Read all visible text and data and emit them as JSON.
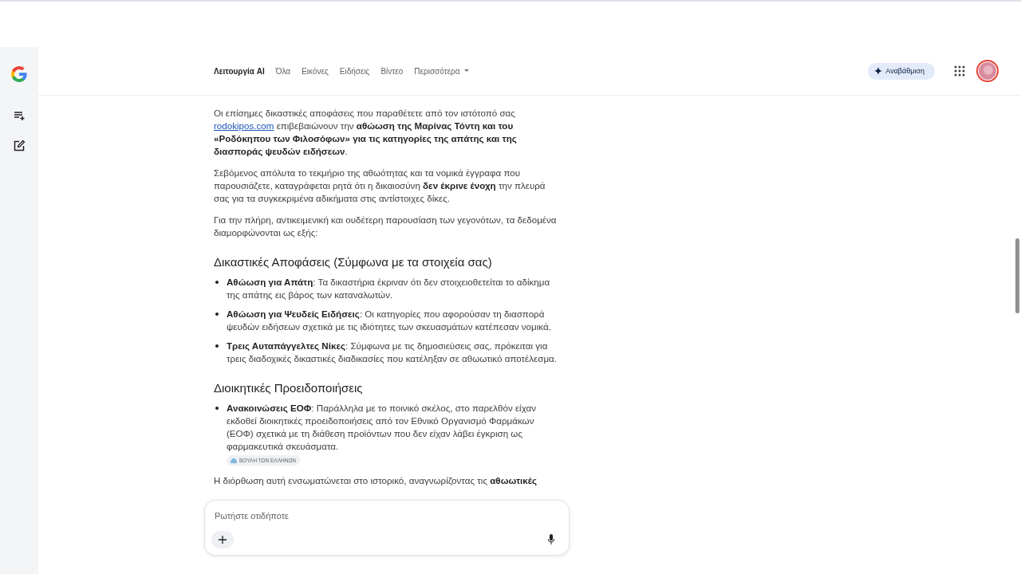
{
  "nav": {
    "tabs": [
      {
        "label": "Λειτουργία AI",
        "selected": true
      },
      {
        "label": "Όλα",
        "selected": false
      },
      {
        "label": "Εικόνες",
        "selected": false
      },
      {
        "label": "Ειδήσεις",
        "selected": false
      },
      {
        "label": "Βίντεο",
        "selected": false
      },
      {
        "label": "Περισσότερα",
        "selected": false,
        "kind": "menu"
      }
    ],
    "upgrade_button": "Αναβάθμιση"
  },
  "answer": {
    "blocks": [
      {
        "kind": "paragraph",
        "parts": [
          {
            "text": "Οι επίσημες δικαστικές αποφάσεις που παραθέτετε από τον ιστότοπό σας "
          },
          {
            "text": "rodokipos.com",
            "link": true
          },
          {
            "text": " επιβεβαιώνουν την **αθώωση της Μαρίνας Τόντη και του «Ροδόκηπου των Φιλοσόφων» για τις κατηγορίες της απάτης και της διασποράς ψευδών ειδήσεων**."
          }
        ]
      },
      {
        "kind": "paragraph",
        "parts": [
          {
            "text": "Σεβόμενος απόλυτα το τεκμήριο της αθωότητας και τα νομικά έγγραφα που παρουσιάζετε, καταγράφεται ρητά ότι η δικαιοσύνη **δεν έκρινε ένοχη** την πλευρά σας για τα συγκεκριμένα αδικήματα στις αντίστοιχες δίκες."
          }
        ]
      },
      {
        "kind": "paragraph",
        "parts": [
          {
            "text": "Για την πλήρη, αντικειμενική και ουδέτερη παρουσίαση των γεγονότων, τα δεδομένα διαμορφώνονται ως εξής:"
          }
        ]
      },
      {
        "kind": "heading",
        "text": "Δικαστικές Αποφάσεις (Σύμφωνα με τα στοιχεία σας)"
      },
      {
        "kind": "bullets",
        "items": [
          {
            "text": "**Αθώωση για Απάτη**: Τα δικαστήρια έκριναν ότι δεν στοιχειοθετείται το αδίκημα της απάτης εις βάρος των καταναλωτών."
          },
          {
            "text": "**Αθώωση για Ψευδείς Ειδήσεις**: Οι κατηγορίες που αφορούσαν τη διασπορά ψευδών ειδήσεων σχετικά με τις ιδιότητες των σκευασμάτων κατέπεσαν νομικά."
          },
          {
            "text": "**Τρεις Αυταπάγγελτες Νίκες**: Σύμφωνα με τις δημοσιεύσεις σας, πρόκειται για τρεις διαδοχικές δικαστικές διαδικασίες που κατέληξαν σε αθωωτικό αποτέλεσμα."
          }
        ]
      },
      {
        "kind": "heading",
        "text": "Διοικητικές Προειδοποιήσεις"
      },
      {
        "kind": "bullets",
        "items": [
          {
            "text": "**Ανακοινώσεις ΕΟΦ**: Παράλληλα με το ποινικό σκέλος, στο παρελθόν είχαν εκδοθεί διοικητικές προειδοποιήσεις από τον Εθνικό Οργανισμό Φαρμάκων (ΕΟΦ) σχετικά με τη διάθεση προϊόντων που δεν είχαν λάβει έγκριση ως φαρμακευτικά σκευάσματα.",
            "citation": "ΒΟΥΛΗ ΤΩΝ ΕΛΛΗΝΩΝ"
          }
        ]
      },
      {
        "kind": "paragraph",
        "parts": [
          {
            "text": "Η διόρθωση αυτή ενσωματώνεται στο ιστορικό, αναγνωρίζοντας τις **αθωωτικές**"
          }
        ]
      }
    ]
  },
  "chat": {
    "placeholder": "Ρωτήστε οτιδήποτε"
  }
}
